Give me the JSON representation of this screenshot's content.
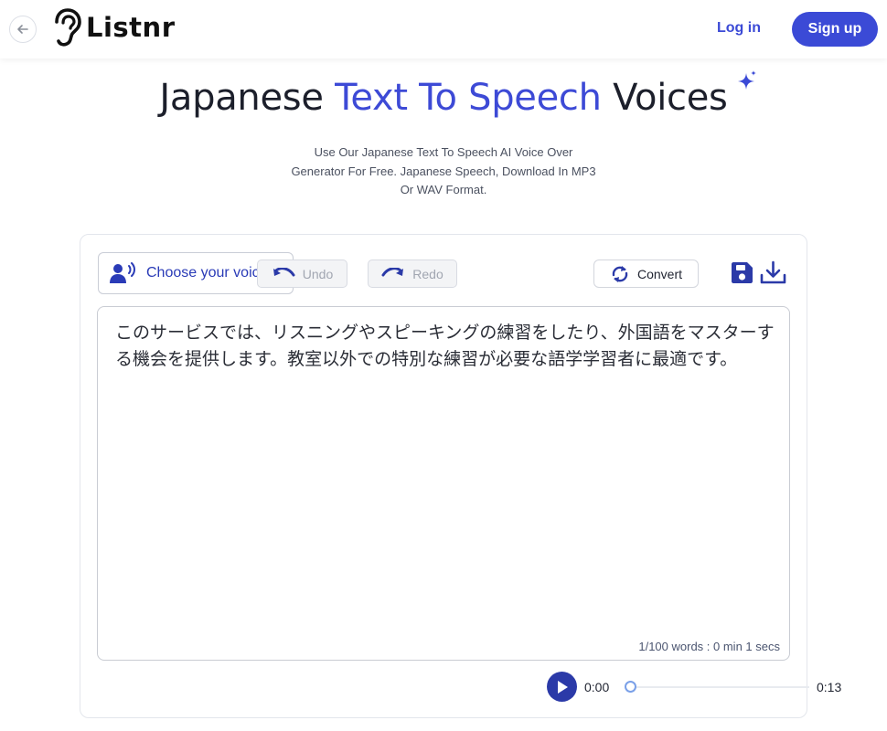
{
  "header": {
    "logo_text": "Listnr",
    "login_label": "Log in",
    "signup_label": "Sign up"
  },
  "hero": {
    "title_part1": "Japanese ",
    "title_accent": "Text To Speech",
    "title_part2": " Voices",
    "subtitle_lines": [
      "Use Our Japanese Text To Speech AI Voice Over",
      "Generator For Free. Japanese Speech, Download In MP3",
      "Or WAV Format."
    ]
  },
  "toolbar": {
    "voice_label": "Choose your voice",
    "undo_label": "Undo",
    "redo_label": "Redo",
    "convert_label": "Convert"
  },
  "editor": {
    "text": "このサービスでは、リスニングやスピーキングの練習をしたり、外国語をマスターする機会を提供します。教室以外での特別な練習が必要な語学学習者に最適です。",
    "word_count": "1/100 words : 0 min 1 secs"
  },
  "player": {
    "current_time": "0:00",
    "total_time": "0:13",
    "progress": 0
  },
  "colors": {
    "accent": "#3b4ad6",
    "play_button": "#2b3aa8"
  }
}
